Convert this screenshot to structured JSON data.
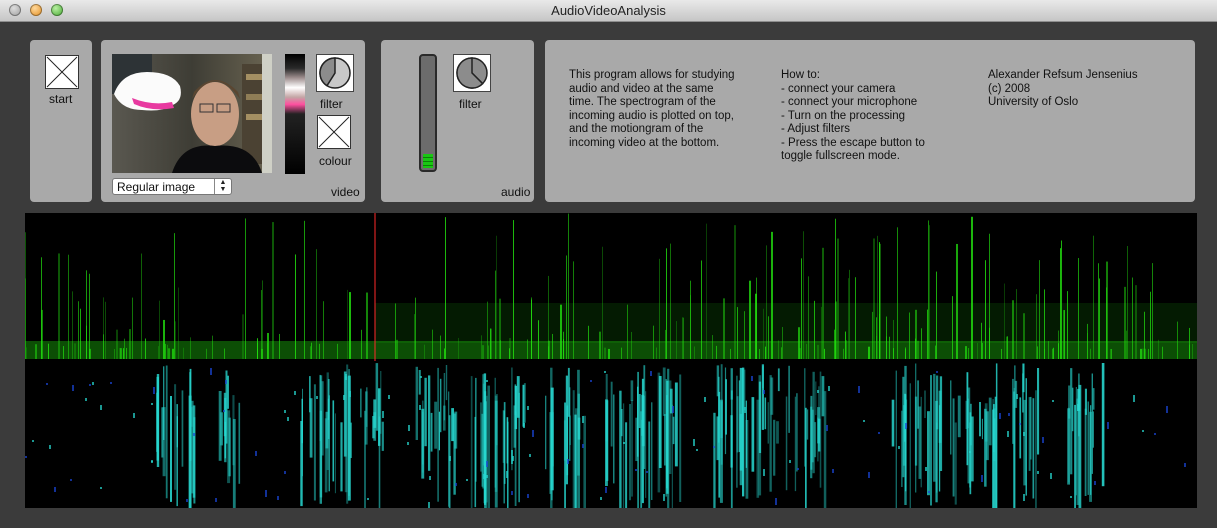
{
  "window": {
    "title": "AudioVideoAnalysis"
  },
  "start_panel": {
    "start_label": "start"
  },
  "video_panel": {
    "filter_label": "filter",
    "colour_label": "colour",
    "panel_label": "video",
    "mode_select_value": "Regular image"
  },
  "audio_panel": {
    "filter_label": "filter",
    "panel_label": "audio"
  },
  "info_panel": {
    "description": "This program allows for studying\naudio and video at the same\ntime. The spectrogram of the\nincoming audio is plotted on top,\nand the motiongram of the\nincoming video at the bottom.",
    "howto": "How to:\n- connect your camera\n- connect your microphone\n- Turn on the processing\n- Adjust filters\n- Press the escape button to\ntoggle fullscreen mode.",
    "credits": "Alexander Refsum Jensenius\n(c) 2008\nUniversity of Oslo"
  },
  "colors": {
    "spectrogram": "#22e00f",
    "motiongram": "#27d8d0",
    "playhead": "#ff2a2a",
    "panel_bg": "#a9a9a9"
  }
}
